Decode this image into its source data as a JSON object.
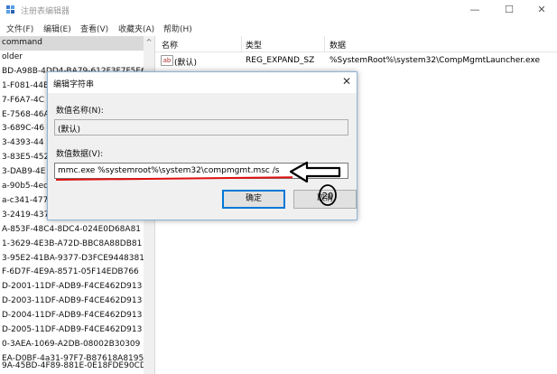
{
  "window": {
    "title": "注册表编辑器",
    "minimize": "—",
    "maximize": "☐",
    "close": "✕"
  },
  "menu": [
    "文件(F)",
    "编辑(E)",
    "查看(V)",
    "收藏夹(A)",
    "帮助(H)"
  ],
  "tree": {
    "items": [
      "command",
      "older",
      "BD-A98B-4DD4-BA79-612F3F7F5E6",
      "1-F081-44B",
      "7-F6A7-4C",
      "E-7568-46A",
      "3-689C-46",
      "3-4393-44",
      "3-83E5-452",
      "3-DAB9-4E",
      "a-90b5-4ed",
      "a-c341-477",
      "3-2419-437",
      "A-853F-48C4-8DC4-024E0D68A81",
      "1-3629-4E3B-A72D-BBC8A88DB81",
      "3-95E2-41BA-9377-D3FCE9448381",
      "F-6D7F-4E9A-8571-05F14EDB766",
      "D-2001-11DF-ADB9-F4CE462D913",
      "D-2003-11DF-ADB9-F4CE462D913",
      "D-2004-11DF-ADB9-F4CE462D913",
      "D-2005-11DF-ADB9-F4CE462D913",
      "0-3AEA-1069-A2DB-08002B30309",
      "EA-D0BF-4a31-97F7-B87618A8195",
      "9A-45BD-4F89-881E-0E18FDE90CD"
    ],
    "scroll_up": "^"
  },
  "list": {
    "headers": {
      "name": "名称",
      "type": "类型",
      "data": "数据"
    },
    "rows": [
      {
        "icon": "ab",
        "name": "(默认)",
        "type": "REG_EXPAND_SZ",
        "data": "%SystemRoot%\\system32\\CompMgmtLauncher.exe"
      }
    ]
  },
  "dialog": {
    "title": "编辑字符串",
    "close": "✕",
    "name_label": "数值名称(N):",
    "name_value": "(默认)",
    "data_label": "数值数据(V):",
    "data_value": "mmc.exe  %systemroot%\\system32\\compmgmt.msc  /s",
    "ok": "确定",
    "cancel": "取消"
  },
  "annotation": {
    "number": "20"
  },
  "colors": {
    "accent": "#0078d7",
    "annotation_red": "#e01010",
    "selection": "#d9d9d9"
  }
}
